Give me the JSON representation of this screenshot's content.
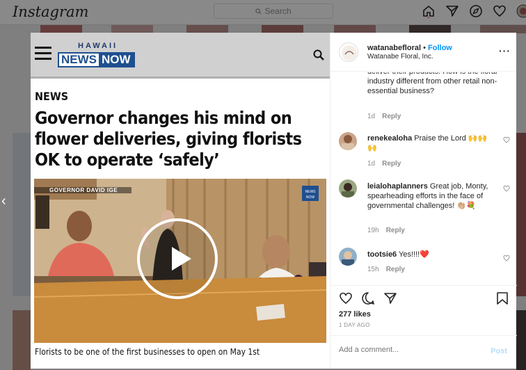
{
  "topbar": {
    "logo": "Instagram",
    "search_placeholder": "Search"
  },
  "media": {
    "brand_top": "HAWAII",
    "brand_news": "NEWS",
    "brand_now": "NOW",
    "section": "NEWS",
    "headline": "Governor changes his mind on flower deliveries, giving florists OK to operate ‘safely’",
    "video_chyron": "GOVERNOR DAVID IGE",
    "caption": "Florists to be one of the first businesses to open on May 1st"
  },
  "post": {
    "author": "watanabefloral",
    "follow": "Follow",
    "subtitle": "Watanabe Floral, Inc."
  },
  "comments": [
    {
      "text": "deliver their products. How is the floral industry different from other retail non-essential business?",
      "time": "1d",
      "reply": "Reply"
    },
    {
      "user": "renekealoha",
      "text": "Praise the Lord 🙌🙌🙌",
      "time": "1d",
      "reply": "Reply"
    },
    {
      "user": "leialohaplanners",
      "text": "Great job, Monty, spearheading efforts in the face of governmental challenges! 👏🏼💐",
      "time": "19h",
      "reply": "Reply"
    },
    {
      "user": "tootsie6",
      "text": "Yes!!!!❤️",
      "time": "15h",
      "reply": "Reply"
    }
  ],
  "stats": {
    "likes": "277 likes",
    "date": "1 DAY AGO"
  },
  "composer": {
    "placeholder": "Add a comment...",
    "post_label": "Post"
  }
}
